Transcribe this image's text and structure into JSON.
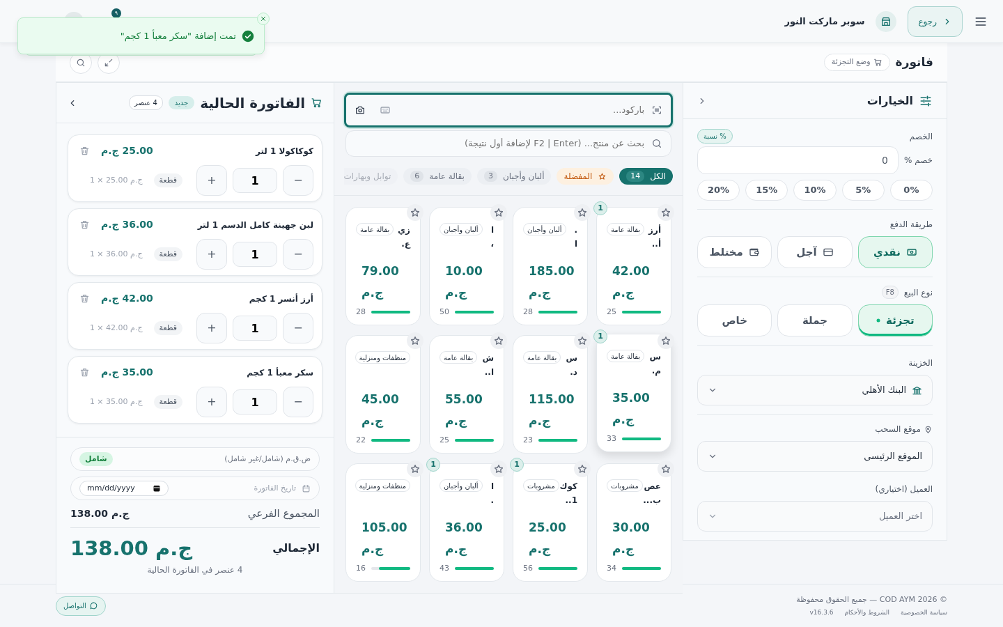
{
  "topbar": {
    "back_button": "رجوع",
    "store_name": "سوبر ماركت النور",
    "notification_count": "٩"
  },
  "toasts": [
    {
      "message": "تمت إضافة \"سكر معبأ 1 كجم\""
    }
  ],
  "page": {
    "title": "فاتورة",
    "mode_badge": "وضع التجزئة"
  },
  "options": {
    "title": "الخيارات",
    "discount": {
      "label": "الخصم",
      "type_badge": "% نسبة",
      "field_label": "خصم %",
      "value": "0",
      "presets": [
        "0%",
        "5%",
        "10%",
        "15%",
        "20%"
      ]
    },
    "payment": {
      "label": "طريقة الدفع",
      "methods": [
        {
          "label": "نقدي",
          "kind": "cash",
          "selected": true
        },
        {
          "label": "آجل",
          "kind": "card",
          "selected": false
        },
        {
          "label": "مختلط",
          "kind": "wallet",
          "selected": false
        }
      ]
    },
    "sale_type": {
      "label": "نوع البيع",
      "shortcut": "F8",
      "types": [
        {
          "label": "تجزئة",
          "selected": true
        },
        {
          "label": "جملة",
          "selected": false
        },
        {
          "label": "خاص",
          "selected": false
        }
      ]
    },
    "treasury": {
      "label": "الخزينة",
      "value": "البنك الأهلي"
    },
    "pickup": {
      "label": "موقع السحب",
      "value": "الموقع الرئيسى"
    },
    "customer": {
      "label": "العميل (اختياري)",
      "placeholder": "اختر العميل"
    }
  },
  "products_panel": {
    "barcode": {
      "placeholder": "باركود..."
    },
    "search": {
      "placeholder": "بحث عن منتج... (F2 | Enter لإضافة أول نتيجة)"
    },
    "categories": [
      {
        "label": "الكل",
        "count": "14",
        "kind": "all",
        "selected": true
      },
      {
        "label": "المفضلة",
        "kind": "favorites",
        "selected": false
      },
      {
        "label": "ألبان وأجبان",
        "count": "3",
        "kind": "category",
        "selected": false
      },
      {
        "label": "بقالة عامة",
        "count": "6",
        "kind": "category",
        "selected": false
      },
      {
        "label": "توابل وبهارات",
        "kind": "category",
        "selected": false
      }
    ],
    "products": [
      {
        "name": "أرز أ..",
        "category": "بقالة عامة",
        "price": "42.00 ج.م",
        "stock": "25",
        "level": 1,
        "in_cart": "1",
        "selected": false
      },
      {
        "name": ". ا",
        "category": "ألبان وأجبان",
        "price": "185.00 ج.م",
        "stock": "28",
        "level": 1,
        "selected": false
      },
      {
        "name": "ا ،",
        "category": "ألبان وأجبان",
        "price": "10.00 ج.م",
        "stock": "50",
        "level": 1,
        "selected": false
      },
      {
        "name": "زي ع.",
        "category": "بقالة عامة",
        "price": "79.00 ج.م",
        "stock": "28",
        "level": 1,
        "selected": false
      },
      {
        "name": "س م.",
        "category": "بقالة عامة",
        "price": "35.00 ج.م",
        "stock": "33",
        "level": 1,
        "in_cart": "1",
        "selected": true
      },
      {
        "name": "س د.",
        "category": "بقالة عامة",
        "price": "115.00 ج.م",
        "stock": "23",
        "level": 1,
        "selected": false
      },
      {
        "name": "ش ا..",
        "category": "بقالة عامة",
        "price": "55.00 ج.م",
        "stock": "25",
        "level": 1,
        "selected": false
      },
      {
        "category": "منظفات ومنزلية",
        "price": "45.00 ج.م",
        "stock": "22",
        "level": 1,
        "selected": false
      },
      {
        "name": "عص ب...",
        "category": "مشروبات",
        "price": "30.00 ج.م",
        "stock": "34",
        "level": 1,
        "selected": false
      },
      {
        "name": "كوك 1..",
        "category": "مشروبات",
        "price": "25.00 ج.م",
        "stock": "56",
        "level": 1,
        "in_cart": "1",
        "selected": false
      },
      {
        "name": "ا .",
        "category": "ألبان وأجبان",
        "price": "36.00 ج.م",
        "stock": "43",
        "level": 1,
        "in_cart": "1",
        "selected": false
      },
      {
        "category": "منظفات ومنزلية",
        "price": "105.00 ج.م",
        "stock": "16",
        "level": 0.8,
        "selected": false
      }
    ]
  },
  "invoice": {
    "title": "الفاتورة الحالية",
    "status": "جديد",
    "count": "4 عنصر",
    "items": [
      {
        "name": "كوكاكولا 1 لتر",
        "price": "25.00 ج.م",
        "qty": "1",
        "unit": "قطعة",
        "unit_line": "ج.م 25.00 × 1",
        "minus": "−",
        "plus": "+"
      },
      {
        "name": "لبن جهينة كامل الدسم 1 لتر",
        "price": "36.00 ج.م",
        "qty": "1",
        "unit": "قطعة",
        "unit_line": "ج.م 36.00 × 1",
        "minus": "−",
        "plus": "+"
      },
      {
        "name": "أرز أنسر 1 كجم",
        "price": "42.00 ج.م",
        "qty": "1",
        "unit": "قطعة",
        "unit_line": "ج.م 42.00 × 1",
        "minus": "−",
        "plus": "+"
      },
      {
        "name": "سكر معبأ 1 كجم",
        "price": "35.00 ج.م",
        "qty": "1",
        "unit": "قطعة",
        "unit_line": "ج.م 35.00 × 1",
        "minus": "−",
        "plus": "+"
      }
    ],
    "tax": {
      "label": "ض.ق.م (شامل/غير شامل)",
      "value": "شامل"
    },
    "date": {
      "label": "تاريخ الفاتورة",
      "placeholder": "mm/dd/yyyy"
    },
    "subtotal": {
      "label": "المجموع الفرعي",
      "value": "ج.م 138.00"
    },
    "total": {
      "label": "الإجمالي",
      "value": "ج.م 138.00"
    },
    "summary": "4 عنصر في الفاتورة الحالية"
  },
  "footer": {
    "copyright": "© 2026 COD AYM — جميع الحقوق محفوظة",
    "links": [
      "سياسة الخصوصية",
      "الشروط والأحكام"
    ],
    "version": "v16.3.6",
    "contact_button": "التواصل"
  }
}
